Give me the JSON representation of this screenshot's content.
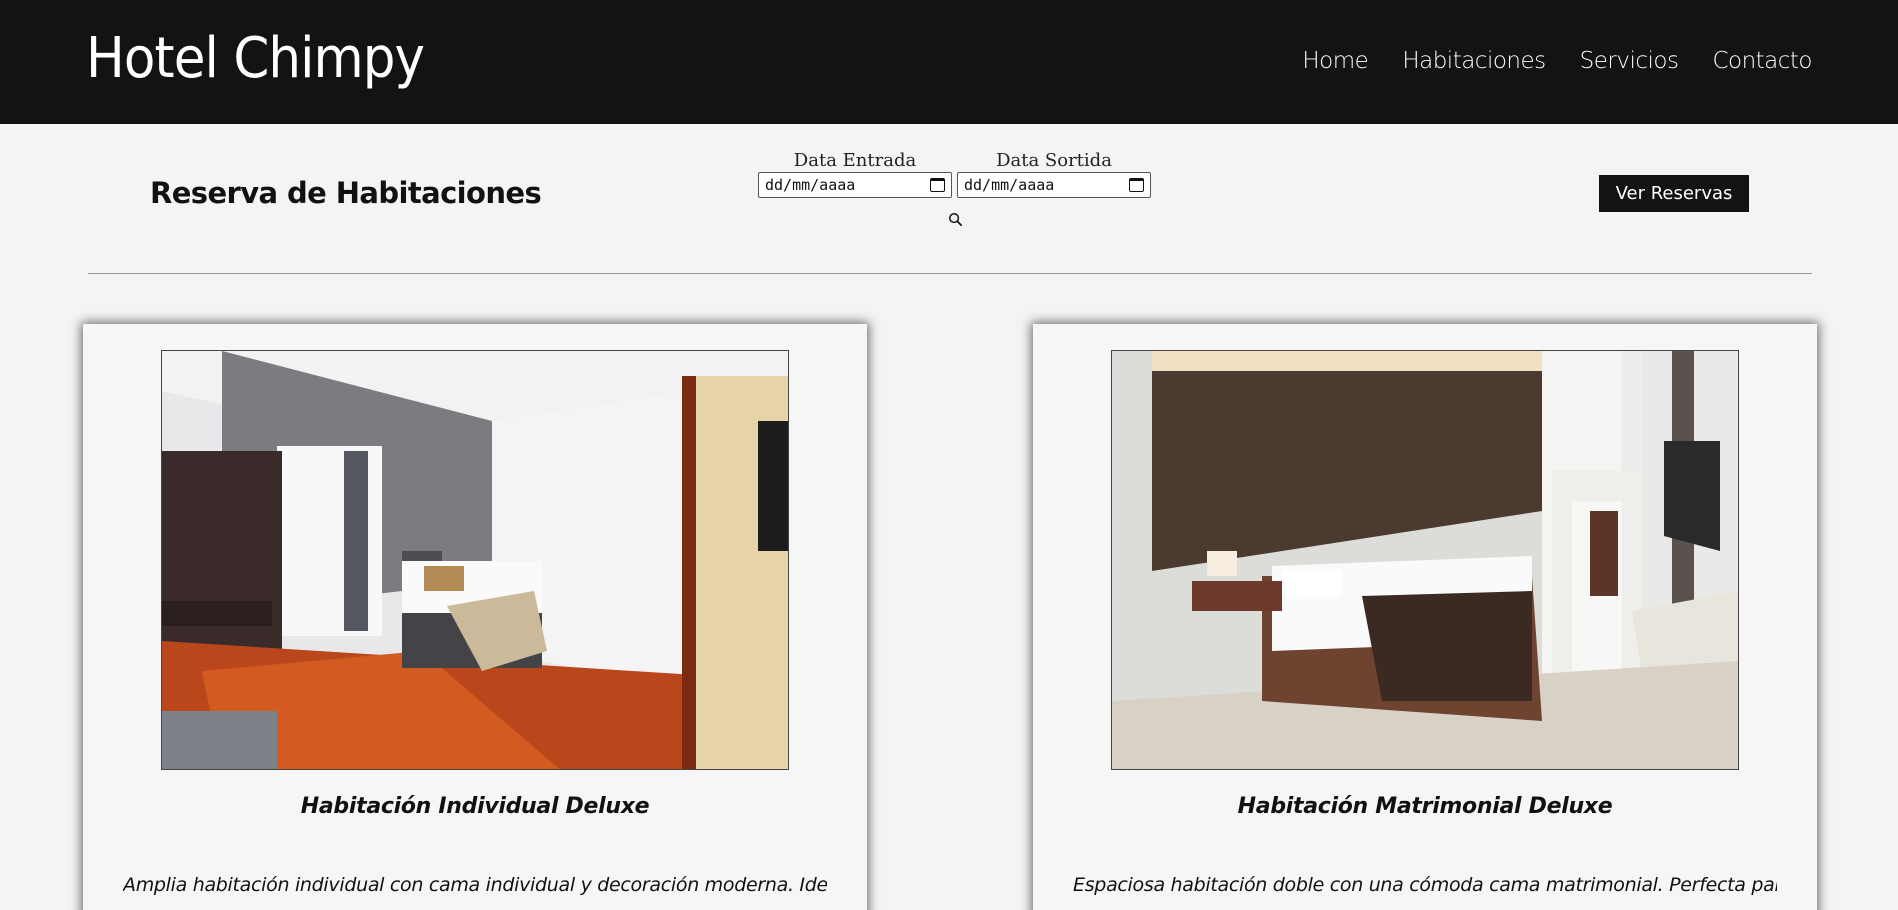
{
  "header": {
    "brand": "Hotel Chimpy",
    "nav": [
      "Home",
      "Habitaciones",
      "Servicios",
      "Contacto"
    ]
  },
  "reservation": {
    "title": "Reserva de Habitaciones",
    "check_in_label": "Data Entrada",
    "check_in_value": "dd/mm/aaaa",
    "check_out_label": "Data Sortida",
    "check_out_value": "dd/mm/aaaa",
    "view_button": "Ver Reservas"
  },
  "rooms": [
    {
      "title": "Habitación Individual Deluxe",
      "description": "Amplia habitación individual con cama individual y decoración moderna. Ideal para"
    },
    {
      "title": "Habitación Matrimonial Deluxe",
      "description": "Espaciosa habitación doble con una cómoda cama matrimonial. Perfecta para"
    }
  ],
  "icons": {
    "search": "search-icon",
    "calendar": "calendar-icon"
  },
  "colors": {
    "header_bg": "#131313",
    "page_bg": "#f4f4f4",
    "button_bg": "#131313"
  }
}
